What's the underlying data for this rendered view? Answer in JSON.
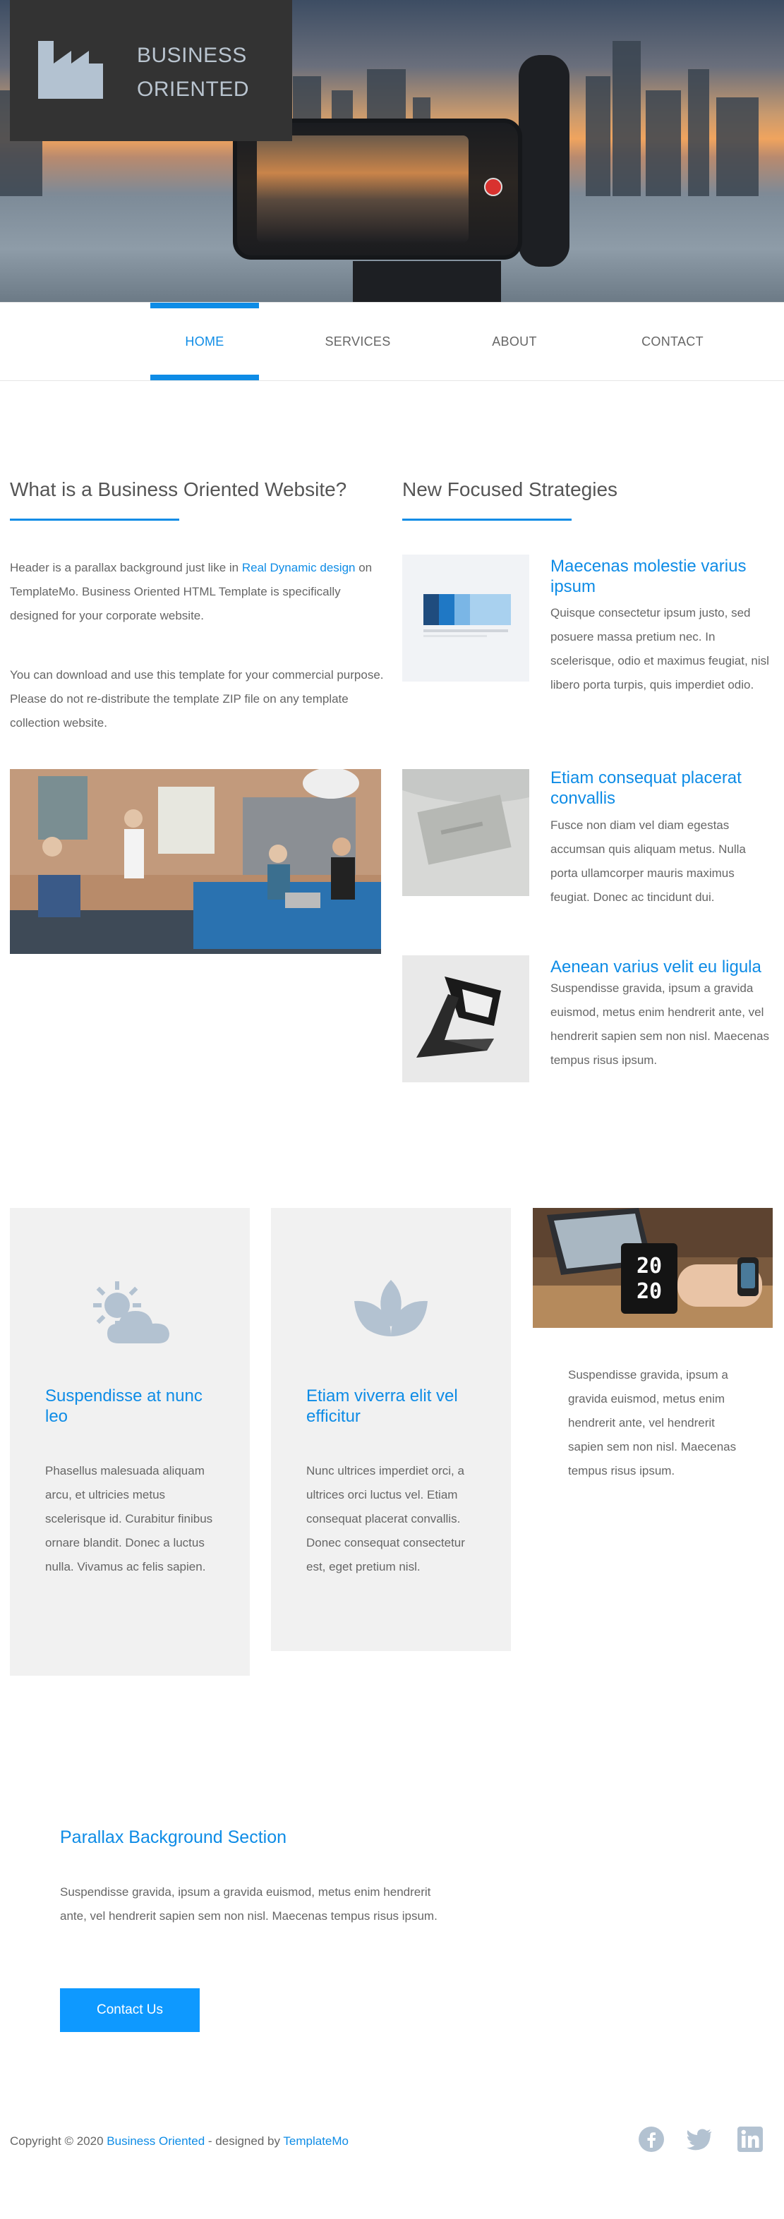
{
  "brand": {
    "line1": "BUSINESS",
    "line2": "ORIENTED",
    "logo_icon": "factory-icon"
  },
  "nav": [
    {
      "label": "HOME",
      "active": true
    },
    {
      "label": "SERVICES",
      "active": false
    },
    {
      "label": "ABOUT",
      "active": false
    },
    {
      "label": "CONTACT",
      "active": false
    }
  ],
  "intro": {
    "title": "What is a Business Oriented Website?",
    "p1_before": "Header is a parallax background just like in ",
    "p1_link": "Real Dynamic design",
    "p1_after": " on TemplateMo. Business Oriented HTML Template is specifically designed for your corporate website.",
    "p2": "You can download and use this template for your commercial purpose. Please do not re-distribute the template ZIP file on any template collection website."
  },
  "strategies": {
    "title": "New Focused Strategies",
    "items": [
      {
        "title": "Maecenas molestie varius ipsum",
        "text": "Quisque consectetur ipsum justo, sed posuere massa pretium nec. In scelerisque, odio et maximus feugiat, nisl libero porta turpis, quis imperdiet odio."
      },
      {
        "title": "Etiam consequat placerat convallis",
        "text": "Fusce non diam vel diam egestas accumsan quis aliquam metus. Nulla porta ullamcorper mauris maximus feugiat. Donec ac tincidunt dui."
      },
      {
        "title": "Aenean varius velit eu ligula",
        "text": "Suspendisse gravida, ipsum a gravida euismod, metus enim hendrerit ante, vel hendrerit sapien sem non nisl. Maecenas tempus risus ipsum."
      }
    ]
  },
  "cards": [
    {
      "icon": "sun-cloud-icon",
      "title": "Suspendisse at nunc leo",
      "text": "Phasellus malesuada aliquam arcu, et ultricies metus scelerisque id. Curabitur finibus ornare blandit. Donec a luctus nulla. Vivamus ac felis sapien."
    },
    {
      "icon": "lotus-icon",
      "title": "Etiam viverra elit vel efficitur",
      "text": "Nunc ultrices imperdiet orci, a ultrices orci luctus vel. Etiam consequat placerat convallis. Donec consequat consectetur est, eget pretium nisl."
    },
    {
      "text": "Suspendisse gravida, ipsum a gravida euismod, metus enim hendrerit ante, vel hendrerit sapien sem non nisl. Maecenas tempus risus ipsum."
    }
  ],
  "mug_label_top": "20",
  "mug_label_bottom": "20",
  "parallax": {
    "title": "Parallax Background Section",
    "text": "Suspendisse gravida, ipsum a gravida euismod, metus enim hendrerit ante, vel hendrerit sapien sem non nisl. Maecenas tempus risus ipsum.",
    "button": "Contact Us"
  },
  "footer": {
    "copyright": "Copyright © 2020 ",
    "brand_link": "Business Oriented",
    "designed_by": " - designed by ",
    "designer_link": "TemplateMo",
    "social": [
      "facebook-icon",
      "twitter-icon",
      "linkedin-icon"
    ]
  },
  "colors": {
    "accent": "#0e8ce6",
    "button": "#0e99ff",
    "icon": "#b3c2d1",
    "card_bg": "#f1f1f1"
  }
}
